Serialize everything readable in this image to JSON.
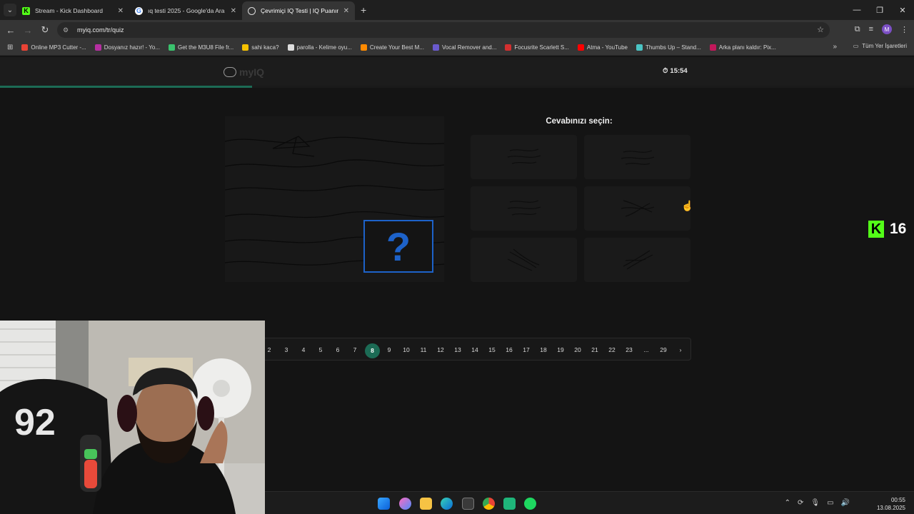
{
  "browser": {
    "tabs": [
      {
        "title": "Stream - Kick Dashboard",
        "icon": "kick-icon",
        "active": false
      },
      {
        "title": "ıq testi 2025 - Google'da Ara",
        "icon": "google-icon",
        "active": false
      },
      {
        "title": "Çevrimiçi IQ Testi | IQ Puanınız:",
        "icon": "myiq-icon",
        "active": true
      }
    ],
    "new_tab": "+",
    "url": "myiq.com/tr/quiz"
  },
  "bookmarks": [
    {
      "label": "Online MP3 Cutter -...",
      "color": "#e94335"
    },
    {
      "label": "Dosyanız hazır! - Yo...",
      "color": "#b62fa1"
    },
    {
      "label": "Get the M3U8 File fr...",
      "color": "#3ac26d"
    },
    {
      "label": "sahi kaca?",
      "color": "#f6c100"
    },
    {
      "label": "parolla - Kelime oyu...",
      "color": "#dddddd"
    },
    {
      "label": "Create Your Best M...",
      "color": "#ff8a00"
    },
    {
      "label": "Vocal Remover and...",
      "color": "#6a5acd"
    },
    {
      "label": "Focusrite Scarlett S...",
      "color": "#d32f2f"
    },
    {
      "label": "Atma - YouTube",
      "color": "#ff0000"
    },
    {
      "label": "Thumbs Up – Stand...",
      "color": "#4ac4c4"
    },
    {
      "label": "Arka planı kaldır: Pix...",
      "color": "#c2185b"
    }
  ],
  "bookmarks_all": "Tüm Yer İşaretleri",
  "site": {
    "logo_text": "myIQ",
    "timer": "15:54",
    "progress_fraction": 0.276,
    "answers_title": "Cevabınızı seçin:",
    "question_mark": "?"
  },
  "pagination": {
    "pages": [
      "2",
      "3",
      "4",
      "5",
      "6",
      "7",
      "8",
      "9",
      "10",
      "11",
      "12",
      "13",
      "14",
      "15",
      "16",
      "17",
      "18",
      "19",
      "20",
      "21",
      "22",
      "23",
      "...",
      "29"
    ],
    "current": "8",
    "next": "›"
  },
  "kick": {
    "viewer_count": "16"
  },
  "clock": {
    "time": "00:55",
    "date": "13.08.2025"
  },
  "colors": {
    "accent": "#1c6b55",
    "question_border": "#1d62c9",
    "kick_green": "#53fc18"
  }
}
